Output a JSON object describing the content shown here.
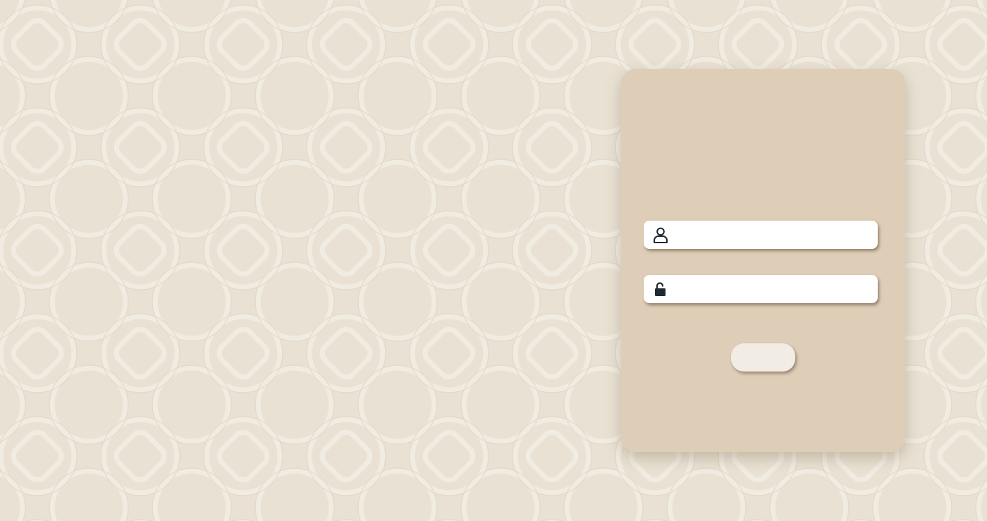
{
  "colors": {
    "background": "#e9e2d4",
    "pattern": "#f3eee4",
    "card": "#decdb7",
    "input_background": "#ffffff",
    "button_background": "#f1ece4",
    "icon": "#1f2a33"
  },
  "login": {
    "title": "",
    "username": {
      "icon": "user-icon",
      "value": "",
      "placeholder": ""
    },
    "password": {
      "icon": "unlocked-padlock-icon",
      "value": "",
      "placeholder": ""
    },
    "submit_label": ""
  }
}
